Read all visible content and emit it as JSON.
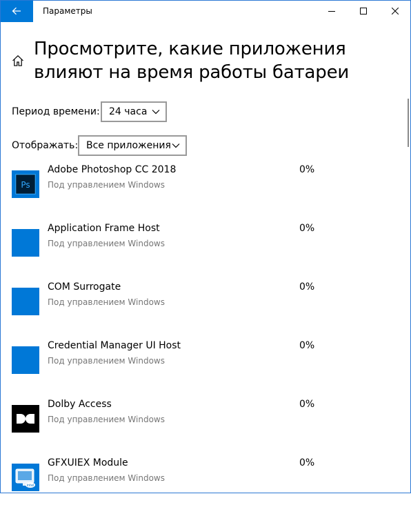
{
  "window": {
    "title": "Параметры"
  },
  "header": {
    "title": "Просмотрите, какие приложения влияют на время работы батареи"
  },
  "filters": {
    "period_label": "Период времени:",
    "period_value": "24 часа",
    "show_label": "Отображать:",
    "show_value": "Все приложения"
  },
  "apps": [
    {
      "name": "Adobe Photoshop CC 2018",
      "subtitle": "Под управлением Windows",
      "percent": "0%",
      "icon": "photoshop-icon"
    },
    {
      "name": "Application Frame Host",
      "subtitle": "Под управлением Windows",
      "percent": "0%",
      "icon": "generic-app-icon"
    },
    {
      "name": "COM Surrogate",
      "subtitle": "Под управлением Windows",
      "percent": "0%",
      "icon": "generic-app-icon"
    },
    {
      "name": "Credential Manager UI Host",
      "subtitle": "Под управлением Windows",
      "percent": "0%",
      "icon": "generic-app-icon"
    },
    {
      "name": "Dolby Access",
      "subtitle": "Под управлением Windows",
      "percent": "0%",
      "icon": "dolby-icon"
    },
    {
      "name": "GFXUIEX Module",
      "subtitle": "Под управлением Windows",
      "percent": "0%",
      "icon": "intel-graphics-icon"
    }
  ],
  "colors": {
    "accent": "#0078d7",
    "photoshop_bg": "#001e36",
    "photoshop_fg": "#31a8ff",
    "secondary_text": "#767676"
  },
  "icons": [
    "back-arrow-icon",
    "minimize-icon",
    "maximize-icon",
    "close-icon",
    "home-icon",
    "chevron-down-icon"
  ]
}
